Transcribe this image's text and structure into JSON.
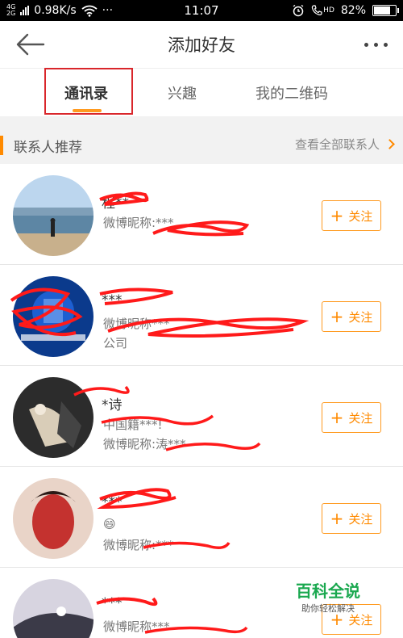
{
  "statusbar": {
    "net_top": "4G",
    "net_bottom": "2G",
    "speed": "0.98K/s",
    "wifi_icon": "wifi-icon",
    "dots": "···",
    "time": "11:07",
    "hd": "HD",
    "battery_percent": "82%",
    "battery_level": 0.82
  },
  "nav": {
    "title": "添加好友",
    "back_icon": "arrow-left-icon",
    "more_icon": "more-dots-icon"
  },
  "tabs": [
    {
      "label": "通讯录",
      "active": true
    },
    {
      "label": "兴趣",
      "active": false
    },
    {
      "label": "我的二维码",
      "active": false
    }
  ],
  "section": {
    "title": "联系人推荐",
    "see_all": "查看全部联系人"
  },
  "contacts": [
    {
      "name": "程**",
      "line1": "微博昵称:***",
      "line2": "",
      "follow": "关注"
    },
    {
      "name": "***",
      "line1": "微博昵称***",
      "line2": "公司",
      "follow": "关注"
    },
    {
      "name": "*诗",
      "line1": "中国籍***!",
      "line2": "微博昵称:涛***",
      "follow": "关注"
    },
    {
      "name": "***",
      "line1": "😄",
      "line2": "微博昵称:***",
      "follow": "关注"
    },
    {
      "name": "***",
      "line1": "微博昵称***",
      "line2": "",
      "follow": "关注"
    }
  ],
  "watermark": {
    "title": "百科全说",
    "subtitle": "助你轻松解决"
  },
  "colors": {
    "accent": "#ff9a1f",
    "highlight": "#d9262b",
    "scribble": "#ff1a1a"
  }
}
